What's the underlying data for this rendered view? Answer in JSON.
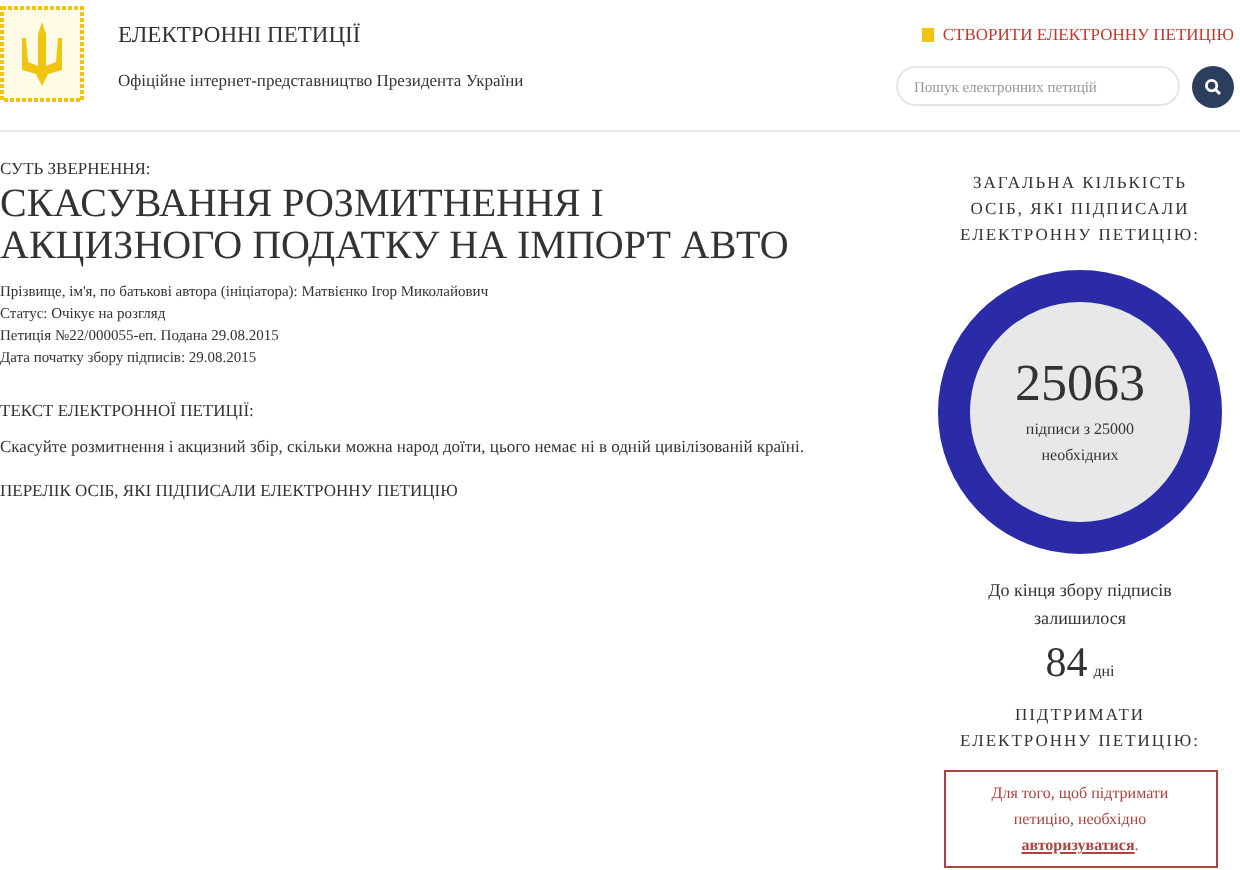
{
  "header": {
    "title": "ЕЛЕКТРОННІ ПЕТИЦІЇ",
    "subtitle": "Офіційне інтернет-представництво Президента України",
    "create_link": "СТВОРИТИ ЕЛЕКТРОННУ ПЕТИЦІЮ",
    "search": {
      "placeholder": "Пошук електронних петицій"
    }
  },
  "petition": {
    "subject_label": "СУТЬ ЗВЕРНЕННЯ:",
    "title": "СКАСУВАННЯ РОЗМИТНЕННЯ І АКЦИЗНОГО ПОДАТКУ НА ІМПОРТ АВТО",
    "meta": [
      "Прізвище, ім'я, по батькові автора (ініціатора): Матвієнко Ігор Миколайович",
      "Статус: Очікує на розгляд",
      "Петиція №22/000055-еп. Подана 29.08.2015",
      "Дата початку збору підписів: 29.08.2015"
    ],
    "text_label": "ТЕКСТ ЕЛЕКТРОННОЇ ПЕТИЦІЇ:",
    "text": "Скасуйте розмитнення і акцизний збір, скільки можна народ доїти, цього немає ні в одній цивілізованій країні.",
    "signers_link": "ПЕРЕЛІК ОСІБ, ЯКІ ПІДПИСАЛИ ЕЛЕКТРОННУ ПЕТИЦІЮ"
  },
  "sidebar": {
    "heading": "ЗАГАЛЬНА КІЛЬКІСТЬ ОСІБ, ЯКІ ПІДПИСАЛИ ЕЛЕКТРОННУ ПЕТИЦІЮ:",
    "progress": {
      "level": 1,
      "count": "25063",
      "caption": "підписи з 25000 необхідних"
    },
    "remaining_label": "До кінця збору підписів залишилося",
    "days": "84",
    "days_unit": "дні",
    "support_heading": "ПІДТРИМАТИ ЕЛЕКТРОННУ ПЕТИЦІЮ:",
    "notice": "Для того, щоб підтримати петицію, необхідно",
    "login_link": "авторизуватися",
    "notice_end": "."
  }
}
